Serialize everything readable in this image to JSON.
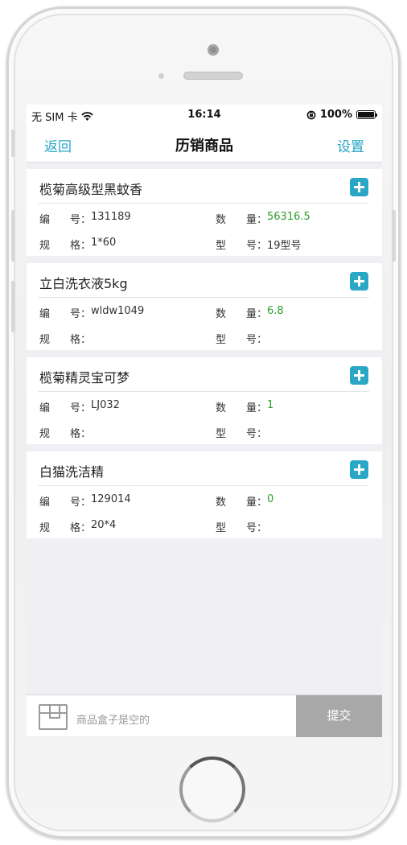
{
  "statusbar": {
    "carrier": "无 SIM 卡",
    "time": "16:14",
    "battery": "100%"
  },
  "navbar": {
    "back": "返回",
    "title": "历销商品",
    "settings": "设置"
  },
  "labels": {
    "code_a": "编",
    "code_b": "号：",
    "qty_a": "数",
    "qty_b": "量：",
    "spec_a": "规",
    "spec_b": "格：",
    "model_a": "型",
    "model_b": "号："
  },
  "products": [
    {
      "name": "榄菊高级型黑蚊香",
      "code": "131189",
      "quantity": "56316.5",
      "spec": "1*60",
      "model": "19型号"
    },
    {
      "name": "立白洗衣液5kg",
      "code": "wldw1049",
      "quantity": "6.8",
      "spec": "",
      "model": ""
    },
    {
      "name": "榄菊精灵宝可梦",
      "code": "LJ032",
      "quantity": "1",
      "spec": "",
      "model": ""
    },
    {
      "name": "白猫洗洁精",
      "code": "129014",
      "quantity": "0",
      "spec": "20*4",
      "model": ""
    }
  ],
  "cart": {
    "empty_text": "商品盒子是空的",
    "submit": "提交"
  },
  "colors": {
    "accent": "#2aa6c6",
    "quantity": "#2e9e2e",
    "submit_bg": "#a8a8a8"
  },
  "icons": {
    "wifi": "wifi-icon",
    "rotation_lock": "rotation-lock-icon",
    "battery": "battery-icon",
    "add": "plus-icon",
    "cart": "box-icon"
  }
}
